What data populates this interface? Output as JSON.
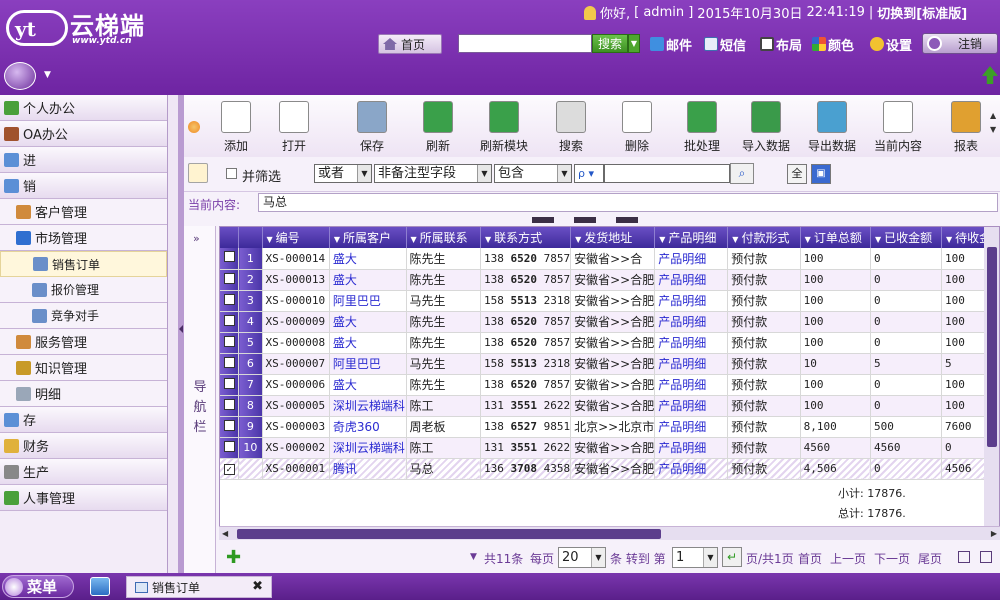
{
  "header": {
    "brand": "云梯端",
    "url": "www.ytd.cn",
    "greeting": "你好,",
    "user": "[ admin ]",
    "date": "2015年10月30日",
    "time": "22:41:19",
    "sep": "|",
    "switch": "切换到[标准版]",
    "home": "首页",
    "search_placeholder": "",
    "search_btn": "搜索",
    "tools": [
      "邮件",
      "短信",
      "布局",
      "颜色",
      "设置"
    ],
    "logout": "注销"
  },
  "sidebar": [
    {
      "label": "个人办公",
      "level": 1,
      "icon": "person-icon"
    },
    {
      "label": "OA办公",
      "level": 1,
      "icon": "briefcase-icon"
    },
    {
      "label": "进",
      "level": 1,
      "icon": "cube-icon"
    },
    {
      "label": "销",
      "level": 1,
      "icon": "cube-icon"
    },
    {
      "label": "客户管理",
      "level": 2,
      "icon": "users-icon"
    },
    {
      "label": "市场管理",
      "level": 2,
      "icon": "chart-icon"
    },
    {
      "label": "销售订单",
      "level": 3,
      "icon": "table-icon",
      "selected": true
    },
    {
      "label": "报价管理",
      "level": 3,
      "icon": "table-icon"
    },
    {
      "label": "竞争对手",
      "level": 3,
      "icon": "table-icon"
    },
    {
      "label": "服务管理",
      "level": 2,
      "icon": "users-icon"
    },
    {
      "label": "知识管理",
      "level": 2,
      "icon": "book-icon"
    },
    {
      "label": "明细",
      "level": 2,
      "icon": "document-icon"
    },
    {
      "label": "存",
      "level": 1,
      "icon": "cube-icon"
    },
    {
      "label": "财务",
      "level": 1,
      "icon": "folder-icon"
    },
    {
      "label": "生产",
      "level": 1,
      "icon": "anchor-icon"
    },
    {
      "label": "人事管理",
      "level": 1,
      "icon": "person-icon"
    }
  ],
  "toolbar": [
    {
      "label": "添加",
      "icon": "new-document-icon"
    },
    {
      "label": "打开",
      "icon": "edit-icon"
    },
    {
      "label": "保存",
      "icon": "save-icon"
    },
    {
      "label": "刷新",
      "icon": "refresh-icon"
    },
    {
      "label": "刷新模块",
      "icon": "refresh-module-icon"
    },
    {
      "label": "搜索",
      "icon": "magnifier-icon"
    },
    {
      "label": "删除",
      "icon": "delete-icon"
    },
    {
      "label": "批处理",
      "icon": "batch-icon"
    },
    {
      "label": "导入数据",
      "icon": "import-excel-icon"
    },
    {
      "label": "导出数据",
      "icon": "export-excel-icon"
    },
    {
      "label": "当前内容",
      "icon": "current-content-icon"
    },
    {
      "label": "报表",
      "icon": "bar-chart-icon"
    }
  ],
  "filter": {
    "filter_label": "并筛选",
    "logic": "或者",
    "field": "非备注型字段",
    "op": "包含",
    "search_icon": "ρ ▾",
    "value": ""
  },
  "current": {
    "label": "当前内容:",
    "value": "马总"
  },
  "nav_panel": {
    "expand": "»",
    "label": "导航栏"
  },
  "grid": {
    "columns": [
      "编号",
      "所属客户",
      "所属联系",
      "联系方式",
      "发货地址",
      "产品明细",
      "付款形式",
      "订单总额",
      "已收金额",
      "待收金"
    ],
    "rows": [
      {
        "n": "1",
        "id": "XS-000014",
        "cust": "盛大",
        "contact": "陈先生",
        "phone_a": "138",
        "phone_b": "6520",
        "phone_c": "7857",
        "addr": "安徽省>>合",
        "product": "产品明细",
        "pay": "预付款",
        "total": "100",
        "recv": "0",
        "pend": "100",
        "checked": false
      },
      {
        "n": "2",
        "id": "XS-000013",
        "cust": "盛大",
        "contact": "陈先生",
        "phone_a": "138",
        "phone_b": "6520",
        "phone_c": "7857",
        "addr": "安徽省>>合肥",
        "product": "产品明细",
        "pay": "预付款",
        "total": "100",
        "recv": "0",
        "pend": "100",
        "checked": false
      },
      {
        "n": "3",
        "id": "XS-000010",
        "cust": "阿里巴巴",
        "contact": "马先生",
        "phone_a": "158",
        "phone_b": "5513",
        "phone_c": "2318",
        "addr": "安徽省>>合肥",
        "product": "产品明细",
        "pay": "预付款",
        "total": "100",
        "recv": "0",
        "pend": "100",
        "checked": false
      },
      {
        "n": "4",
        "id": "XS-000009",
        "cust": "盛大",
        "contact": "陈先生",
        "phone_a": "138",
        "phone_b": "6520",
        "phone_c": "7857",
        "addr": "安徽省>>合肥",
        "product": "产品明细",
        "pay": "预付款",
        "total": "100",
        "recv": "0",
        "pend": "100",
        "checked": false
      },
      {
        "n": "5",
        "id": "XS-000008",
        "cust": "盛大",
        "contact": "陈先生",
        "phone_a": "138",
        "phone_b": "6520",
        "phone_c": "7857",
        "addr": "安徽省>>合肥",
        "product": "产品明细",
        "pay": "预付款",
        "total": "100",
        "recv": "0",
        "pend": "100",
        "checked": false
      },
      {
        "n": "6",
        "id": "XS-000007",
        "cust": "阿里巴巴",
        "contact": "马先生",
        "phone_a": "158",
        "phone_b": "5513",
        "phone_c": "2318",
        "addr": "安徽省>>合肥",
        "product": "产品明细",
        "pay": "预付款",
        "total": "10",
        "recv": "5",
        "pend": "5",
        "checked": false
      },
      {
        "n": "7",
        "id": "XS-000006",
        "cust": "盛大",
        "contact": "陈先生",
        "phone_a": "138",
        "phone_b": "6520",
        "phone_c": "7857",
        "addr": "安徽省>>合肥",
        "product": "产品明细",
        "pay": "预付款",
        "total": "100",
        "recv": "0",
        "pend": "100",
        "checked": false
      },
      {
        "n": "8",
        "id": "XS-000005",
        "cust": "深圳云梯端科",
        "contact": "陈工",
        "phone_a": "131",
        "phone_b": "3551",
        "phone_c": "2622",
        "addr": "安徽省>>合肥",
        "product": "产品明细",
        "pay": "预付款",
        "total": "100",
        "recv": "0",
        "pend": "100",
        "checked": false
      },
      {
        "n": "9",
        "id": "XS-000003",
        "cust": "奇虎360",
        "contact": "周老板",
        "phone_a": "138",
        "phone_b": "6527",
        "phone_c": "9851",
        "addr": "北京>>北京市",
        "product": "产品明细",
        "pay": "预付款",
        "total": "8,100",
        "recv": "500",
        "pend": "7600",
        "checked": false
      },
      {
        "n": "10",
        "id": "XS-000002",
        "cust": "深圳云梯端科",
        "contact": "陈工",
        "phone_a": "131",
        "phone_b": "3551",
        "phone_c": "2622",
        "addr": "安徽省>>合肥",
        "product": "产品明细",
        "pay": "预付款",
        "total": "4560",
        "recv": "4560",
        "pend": "0",
        "checked": false
      },
      {
        "n": "",
        "id": "XS-000001",
        "cust": "腾讯",
        "contact": "马总",
        "phone_a": "136",
        "phone_b": "3708",
        "phone_c": "4358",
        "addr": "安徽省>>合肥",
        "product": "产品明细",
        "pay": "预付款",
        "total": "4,506",
        "recv": "0",
        "pend": "4506",
        "checked": true
      }
    ],
    "subtotal": "小计: 17876.",
    "total": "总计: 17876."
  },
  "pager": {
    "total": "共11条",
    "per_page_label": "每页",
    "per_page": "20",
    "goto_label": "条 转到 第",
    "page": "1",
    "page_of": "页/共1页",
    "first": "首页",
    "prev": "上一页",
    "next": "下一页",
    "last": "尾页"
  },
  "taskbar": {
    "start": "菜单",
    "tab": "销售订单",
    "close": "✖"
  },
  "colors": {
    "brand": "#7a2fae",
    "grid_header": "#4f38ad",
    "link": "#2b2bd1"
  }
}
